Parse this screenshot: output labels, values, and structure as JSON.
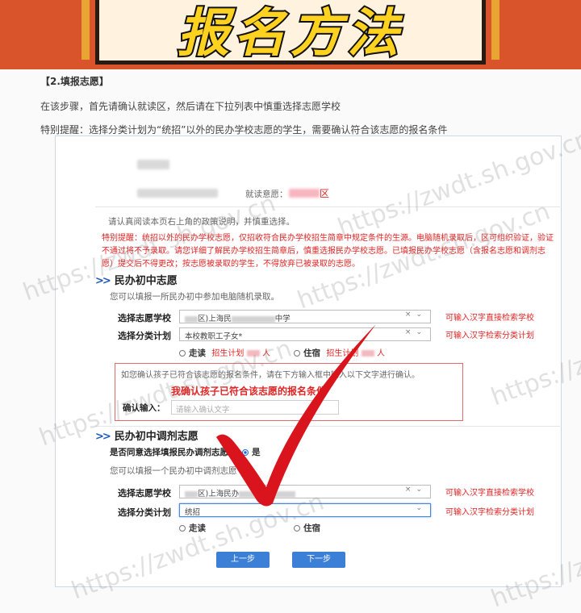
{
  "banner": {
    "title": "报名方法"
  },
  "intro": {
    "section": "【2.填报志愿】",
    "line1": "在该步骤，首先请确认就读区，然后请在下拉列表中慎重选择志愿学校",
    "line2": "特别提醒：选择分类计划为“统招”以外的民办学校志愿的学生，需要确认符合该志愿的报名条件"
  },
  "header_info": {
    "intent_label": "就读意愿：",
    "intent_suffix": "区"
  },
  "notes": {
    "read": "请认真阅读本页右上角的政策说明，并慎重选择。",
    "warn_l1": "特别提醒：统招以外的民办学校志愿，仅招收符合民办学校招生简章中规定条件的生源。电脑随机录取后，区可组织验证，验证",
    "warn_l2": "不通过将不予录取。请您详细了解民办学校招生简章后，慎重选报民办学校志愿。已填报民办学校志愿（含报名志愿和调剂志",
    "warn_l3": "愿）提交后不得更改；按志愿被录取的学生，不得放弃已被录取的志愿。"
  },
  "section1": {
    "title": "民办初中志愿",
    "desc": "您可以填报一所民办初中参加电脑随机录取。",
    "school_label": "选择志愿学校",
    "school_value_mid": "区)上海民",
    "school_value_end": "中学",
    "school_hint": "可输入汉字直接检索学校",
    "plan_label": "选择分类计划",
    "plan_value": "本校教职工子女*",
    "plan_hint": "可输入汉字检索分类计划",
    "opt_day": "走读",
    "opt_board": "住宿",
    "quota_label": "招生计划",
    "quota_unit": "人",
    "confirm_prompt": "如您确认孩子已符合该志愿的报名条件，请在下方输入框中输入以下文字进行确认。",
    "confirm_text": "我确认孩子已符合该志愿的报名条件",
    "confirm_label": "确认输入：",
    "confirm_placeholder": "请输入确认文字"
  },
  "section2": {
    "title": "民办初中调剂志愿",
    "agree_q": "是否同意选择填报民办调剂志愿",
    "agree_yes": "是",
    "desc": "您可以填报一个民办初中调剂志愿",
    "school_label": "选择志愿学校",
    "school_value_mid": "区)上海民办",
    "school_hint": "可输入汉字直接检索学校",
    "plan_label": "选择分类计划",
    "plan_value": "统招",
    "plan_hint": "可输入汉字检索分类计划",
    "opt_day": "走读",
    "opt_board": "住宿"
  },
  "buttons": {
    "prev": "上一步",
    "next": "下一步"
  },
  "watermark": "https://zwdt.sh.gov.cn",
  "colors": {
    "banner": "#d9542b",
    "accent": "#1e5bb8",
    "warn": "#e02424",
    "button": "#3b7fd6",
    "check": "#d9141c"
  }
}
